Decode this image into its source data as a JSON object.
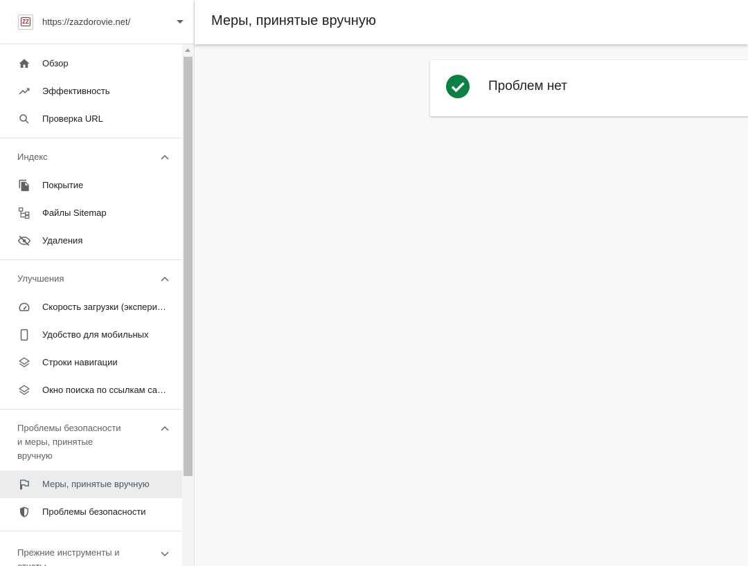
{
  "property": {
    "url": "https://zazdorovie.net/",
    "favicon_text": "ZZ"
  },
  "header": {
    "title": "Меры, принятые вручную"
  },
  "nav": {
    "top": [
      {
        "label": "Обзор",
        "icon": "home-icon"
      },
      {
        "label": "Эффективность",
        "icon": "trending-up-icon"
      },
      {
        "label": "Проверка URL",
        "icon": "search-icon"
      }
    ],
    "index": {
      "title": "Индекс",
      "items": [
        {
          "label": "Покрытие",
          "icon": "file-copy-icon"
        },
        {
          "label": "Файлы Sitemap",
          "icon": "sitemap-icon"
        },
        {
          "label": "Удаления",
          "icon": "eye-off-icon"
        }
      ]
    },
    "enhancements": {
      "title": "Улучшения",
      "items": [
        {
          "label": "Скорость загрузки (экспериментальная функция)",
          "icon": "speed-icon"
        },
        {
          "label": "Удобство для мобильных",
          "icon": "smartphone-icon"
        },
        {
          "label": "Строки навигации",
          "icon": "layers-icon"
        },
        {
          "label": "Окно поиска по ссылкам сайта",
          "icon": "layers-icon"
        }
      ]
    },
    "security": {
      "title_line1": "Проблемы безопасности",
      "title_line2": "и меры, принятые",
      "title_line3": "вручную",
      "items": [
        {
          "label": "Меры, принятые вручную",
          "icon": "flag-icon",
          "active": true
        },
        {
          "label": "Проблемы безопасности",
          "icon": "shield-icon"
        }
      ]
    },
    "legacy": {
      "title_line1": "Прежние инструменты и",
      "title_line2": "отчеты"
    }
  },
  "main": {
    "status_text": "Проблем нет"
  },
  "colors": {
    "success": "#0b8043",
    "active_bg": "#ececec",
    "active_text": "#455a64"
  }
}
